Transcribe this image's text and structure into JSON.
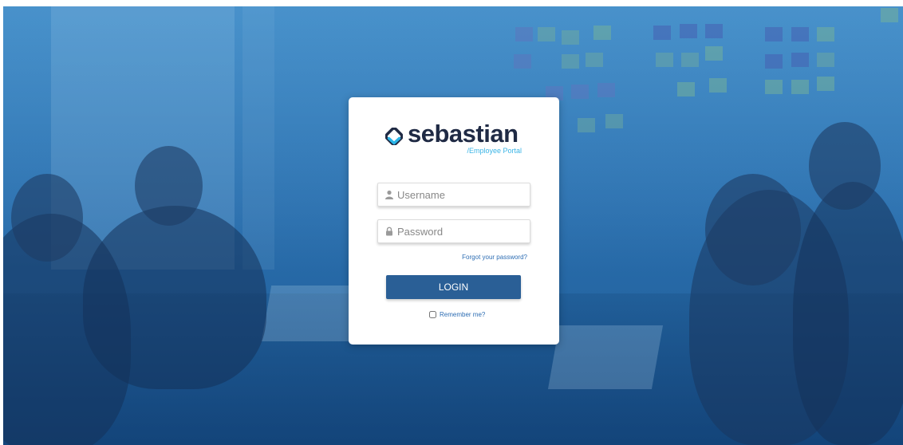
{
  "brand": {
    "name": "sebastian",
    "subtitle": "/Employee Portal",
    "mark_color": "#2ab5e8"
  },
  "form": {
    "username": {
      "placeholder": "Username",
      "value": "",
      "icon": "user-icon"
    },
    "password": {
      "placeholder": "Password",
      "value": "",
      "icon": "lock-icon"
    },
    "forgot_label": "Forgot your password?",
    "login_label": "LOGIN",
    "remember_label": "Remember me?",
    "remember_checked": false
  },
  "colors": {
    "background": "#2a6fae",
    "button": "#2a5f96",
    "link": "#2d6db3",
    "brand_text": "#1f2a44"
  }
}
